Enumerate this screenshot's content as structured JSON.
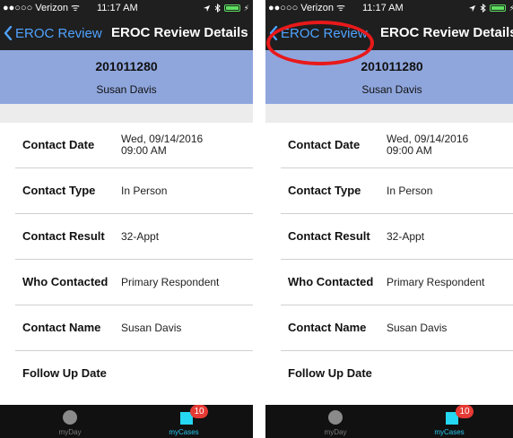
{
  "screens": [
    {
      "status": {
        "carrier": "●●○○○ Verizon ᯤ",
        "time": "11:17 AM"
      },
      "nav": {
        "back_label": "EROC Review",
        "title": "EROC Review Details"
      },
      "header": {
        "case_id": "201011280",
        "name": "Susan Davis"
      },
      "rows": [
        {
          "label": "Contact Date",
          "value_line1": "Wed, 09/14/2016",
          "value_line2": "09:00 AM"
        },
        {
          "label": "Contact Type",
          "value_line1": "In Person",
          "value_line2": ""
        },
        {
          "label": "Contact Result",
          "value_line1": "32-Appt",
          "value_line2": ""
        },
        {
          "label": "Who Contacted",
          "value_line1": "Primary Respondent",
          "value_line2": ""
        },
        {
          "label": "Contact Name",
          "value_line1": "Susan Davis",
          "value_line2": ""
        },
        {
          "label": "Follow Up Date",
          "value_line1": "",
          "value_line2": ""
        }
      ],
      "tabs": {
        "myday_label": "myDay",
        "mycases_label": "myCases",
        "mycases_badge": "10"
      }
    },
    {
      "status": {
        "carrier": "●●○○○ Verizon ᯤ",
        "time": "11:17 AM"
      },
      "nav": {
        "back_label": "EROC Review",
        "title": "EROC Review Details"
      },
      "header": {
        "case_id": "201011280",
        "name": "Susan Davis"
      },
      "rows": [
        {
          "label": "Contact Date",
          "value_line1": "Wed, 09/14/2016",
          "value_line2": "09:00 AM"
        },
        {
          "label": "Contact Type",
          "value_line1": "In Person",
          "value_line2": ""
        },
        {
          "label": "Contact Result",
          "value_line1": "32-Appt",
          "value_line2": ""
        },
        {
          "label": "Who Contacted",
          "value_line1": "Primary Respondent",
          "value_line2": ""
        },
        {
          "label": "Contact Name",
          "value_line1": "Susan Davis",
          "value_line2": ""
        },
        {
          "label": "Follow Up Date",
          "value_line1": "",
          "value_line2": ""
        }
      ],
      "tabs": {
        "myday_label": "myDay",
        "mycases_label": "myCases",
        "mycases_badge": "10"
      }
    }
  ],
  "colors": {
    "nav_bg": "#1f1f1f",
    "back_link": "#4fa3ff",
    "header_band": "#8fa6dd",
    "badge": "#e53a35",
    "tab_active": "#25d7f2",
    "annotation_ring": "#e8191a"
  },
  "icons": [
    "chevron-left-icon",
    "wifi-icon",
    "location-icon",
    "bluetooth-icon",
    "battery-icon",
    "myday-circle-icon",
    "mycases-square-icon"
  ]
}
